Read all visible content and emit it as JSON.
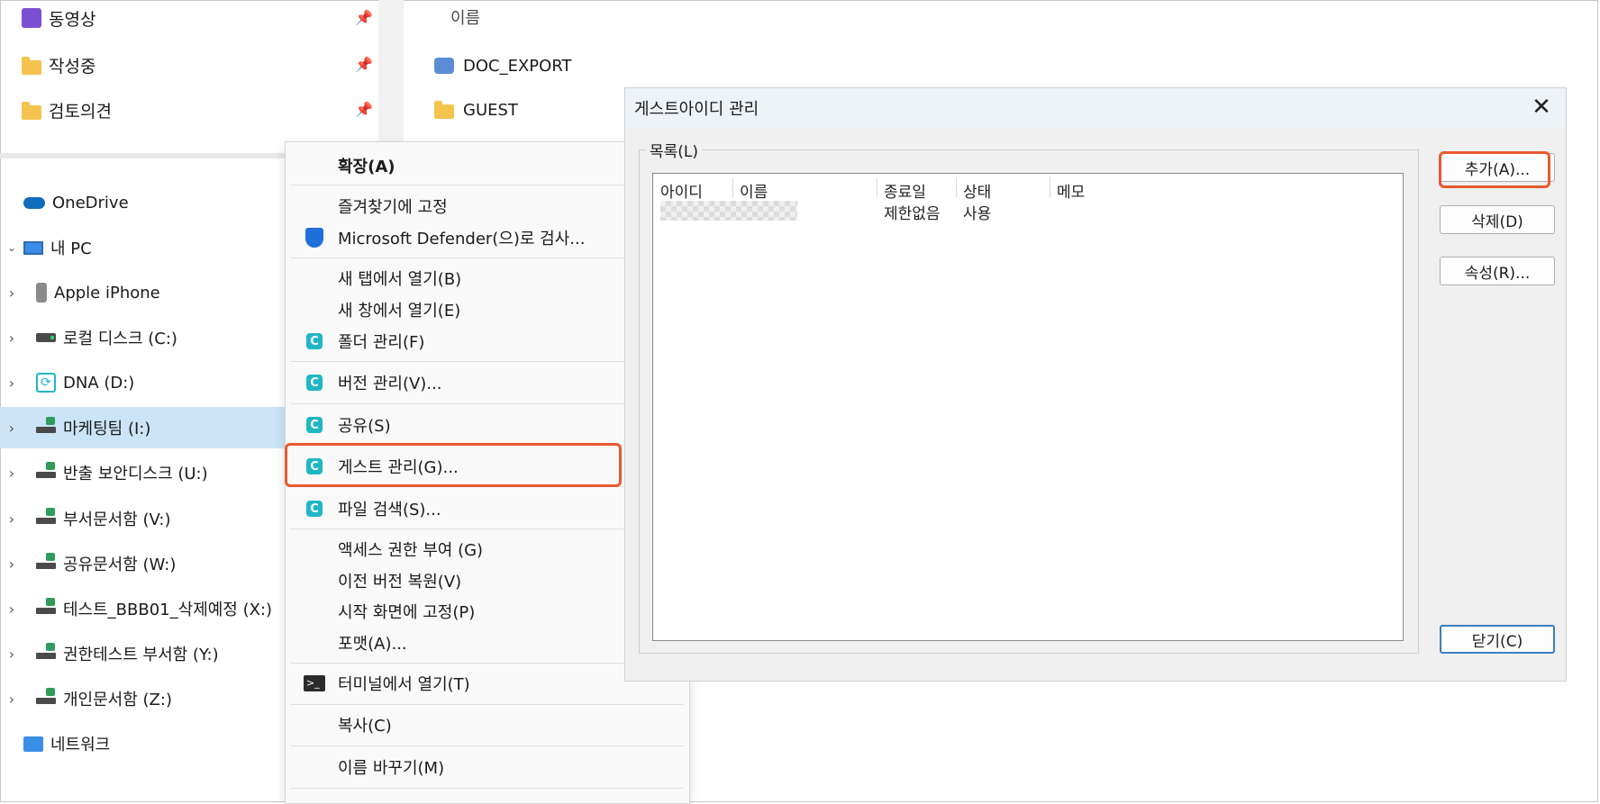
{
  "quick_access": [
    {
      "label": "동영상",
      "icon": "video-icon"
    },
    {
      "label": "작성중",
      "icon": "folder-icon"
    },
    {
      "label": "검토의견",
      "icon": "folder-icon"
    }
  ],
  "file_list": {
    "column_name": "이름",
    "items": [
      {
        "label": "DOC_EXPORT",
        "icon": "shared-folder-icon"
      },
      {
        "label": "GUEST",
        "icon": "folder-icon"
      }
    ]
  },
  "nav": {
    "onedrive": "OneDrive",
    "this_pc": "내 PC",
    "drives": [
      {
        "label": "Apple iPhone"
      },
      {
        "label": "로컬 디스크 (C:)"
      },
      {
        "label": "DNA (D:)"
      },
      {
        "label": "마케팅팀 (I:)",
        "selected": true
      },
      {
        "label": "반출 보안디스크 (U:)"
      },
      {
        "label": "부서문서함 (V:)"
      },
      {
        "label": "공유문서함 (W:)"
      },
      {
        "label": "테스트_BBB01_삭제예정 (X:)"
      },
      {
        "label": "권한테스트 부서함 (Y:)"
      },
      {
        "label": "개인문서함 (Z:)"
      }
    ],
    "network": "네트워크"
  },
  "context_menu": {
    "expand": "확장(A)",
    "pin_favorites": "즐겨찾기에 고정",
    "defender": "Microsoft Defender(으)로 검사...",
    "open_new_tab": "새 탭에서 열기(B)",
    "open_new_window": "새 창에서 열기(E)",
    "folder_manage": "폴더 관리(F)",
    "version_manage": "버전 관리(V)...",
    "share": "공유(S)",
    "guest_manage": "게스트 관리(G)...",
    "file_search": "파일 검색(S)...",
    "grant_access": "액세스 권한 부여 (G)",
    "restore_prev": "이전 버전 복원(V)",
    "pin_start": "시작 화면에 고정(P)",
    "format": "포맷(A)...",
    "open_terminal": "터미널에서 열기(T)",
    "copy": "복사(C)",
    "rename": "이름 바꾸기(M)"
  },
  "dialog": {
    "title": "게스트아이디 관리",
    "close_glyph": "✕",
    "group_label": "목록(L)",
    "columns": [
      "아이디",
      "이름",
      "종료일",
      "상태",
      "메모"
    ],
    "rows": [
      {
        "end_date": "제한없음",
        "status": "사용"
      }
    ],
    "buttons": {
      "add": "추가(A)...",
      "delete": "삭제(D)",
      "properties": "속성(R)...",
      "close": "닫기(C)"
    }
  },
  "colors": {
    "highlight": "#e8592e",
    "selection": "#cce4f7",
    "app_icon": "#20b7c4"
  }
}
